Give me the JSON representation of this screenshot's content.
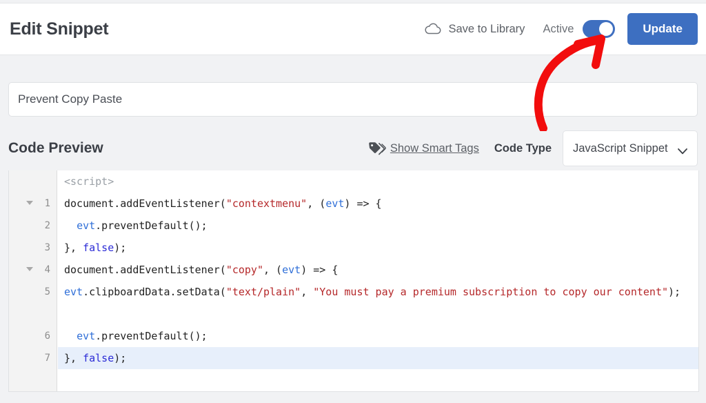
{
  "header": {
    "title": "Edit Snippet",
    "save_to_library_label": "Save to Library",
    "save_to_library_icon": "cloud-icon",
    "active_label": "Active",
    "toggle_state": "on",
    "update_label": "Update",
    "accent_color": "#3d6fc1",
    "toggle_color": "#3f6fc0"
  },
  "snippet": {
    "title_value": "Prevent Copy Paste",
    "title_placeholder": "Add title for snippet"
  },
  "code_preview": {
    "heading": "Code Preview",
    "smart_tags_label": "Show Smart Tags",
    "smart_tags_icon": "tag-icon",
    "code_type_label": "Code Type",
    "code_type_value": "JavaScript Snippet",
    "code_type_caret_icon": "chevron-down-icon"
  },
  "editor": {
    "active_line": 7,
    "lines": [
      {
        "num": "",
        "foldable": false,
        "active": false,
        "wrapped": false,
        "tokens": [
          {
            "t": "tag",
            "s": "<script>"
          }
        ]
      },
      {
        "num": "1",
        "foldable": true,
        "active": false,
        "wrapped": false,
        "tokens": [
          {
            "t": "plain",
            "s": "document.addEventListener("
          },
          {
            "t": "str",
            "s": "\"contextmenu\""
          },
          {
            "t": "plain",
            "s": ", ("
          },
          {
            "t": "var",
            "s": "evt"
          },
          {
            "t": "plain",
            "s": ") => {"
          }
        ]
      },
      {
        "num": "2",
        "foldable": false,
        "active": false,
        "wrapped": false,
        "tokens": [
          {
            "t": "plain",
            "s": "  "
          },
          {
            "t": "var",
            "s": "evt"
          },
          {
            "t": "plain",
            "s": ".preventDefault();"
          }
        ]
      },
      {
        "num": "3",
        "foldable": false,
        "active": false,
        "wrapped": false,
        "tokens": [
          {
            "t": "plain",
            "s": "}, "
          },
          {
            "t": "kw",
            "s": "false"
          },
          {
            "t": "plain",
            "s": ");"
          }
        ]
      },
      {
        "num": "4",
        "foldable": true,
        "active": false,
        "wrapped": false,
        "tokens": [
          {
            "t": "plain",
            "s": "document.addEventListener("
          },
          {
            "t": "str",
            "s": "\"copy\""
          },
          {
            "t": "plain",
            "s": ", ("
          },
          {
            "t": "var",
            "s": "evt"
          },
          {
            "t": "plain",
            "s": ") => {"
          }
        ]
      },
      {
        "num": "5",
        "foldable": false,
        "active": false,
        "wrapped": true,
        "tokens": [
          {
            "t": "plain",
            "s": "  "
          },
          {
            "t": "var",
            "s": "evt"
          },
          {
            "t": "plain",
            "s": ".clipboardData.setData("
          },
          {
            "t": "str",
            "s": "\"text/plain\""
          },
          {
            "t": "plain",
            "s": ", "
          },
          {
            "t": "str",
            "s": "\"You must pay a premium subscription to copy our content\""
          },
          {
            "t": "plain",
            "s": ");"
          }
        ]
      },
      {
        "num": "6",
        "foldable": false,
        "active": false,
        "wrapped": false,
        "tokens": [
          {
            "t": "plain",
            "s": "  "
          },
          {
            "t": "var",
            "s": "evt"
          },
          {
            "t": "plain",
            "s": ".preventDefault();"
          }
        ]
      },
      {
        "num": "7",
        "foldable": false,
        "active": true,
        "wrapped": false,
        "tokens": [
          {
            "t": "plain",
            "s": "}, "
          },
          {
            "t": "kw",
            "s": "false"
          },
          {
            "t": "plain",
            "s": ");"
          }
        ]
      }
    ]
  },
  "annotation": {
    "type": "arrow",
    "color": "#f20d0d",
    "points_to": "active-toggle"
  }
}
